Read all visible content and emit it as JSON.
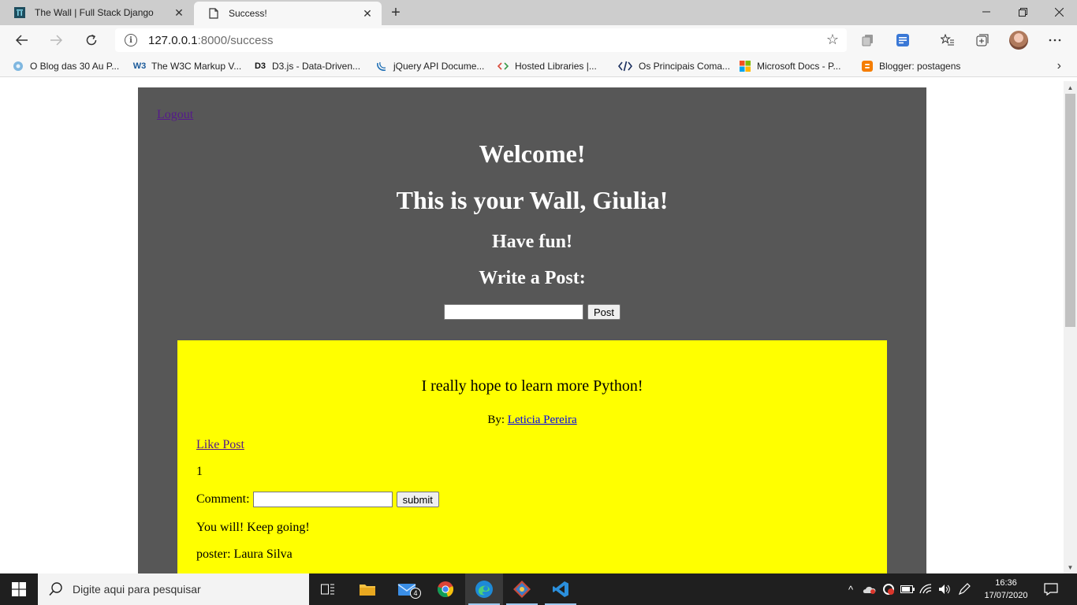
{
  "browser": {
    "tabs": [
      {
        "title": "The Wall | Full Stack Django",
        "active": false
      },
      {
        "title": "Success!",
        "active": true
      }
    ],
    "address": {
      "host": "127.0.0.1",
      "path": ":8000/success"
    },
    "bookmarks": [
      {
        "label": "O Blog das 30 Au P...",
        "icon": "globe-icon"
      },
      {
        "label": "The W3C Markup V...",
        "icon": "w3c-icon"
      },
      {
        "label": "D3.js - Data-Driven...",
        "icon": "d3-icon"
      },
      {
        "label": "jQuery API Docume...",
        "icon": "jquery-icon"
      },
      {
        "label": "Hosted Libraries  |...",
        "icon": "code-icon"
      },
      {
        "label": "Os Principais Coma...",
        "icon": "code-tag-icon"
      },
      {
        "label": "Microsoft Docs - P...",
        "icon": "microsoft-icon"
      },
      {
        "label": "Blogger: postagens",
        "icon": "blogger-icon"
      }
    ]
  },
  "page": {
    "logout_label": "Logout",
    "welcome": "Welcome!",
    "wall_title": "This is your Wall, Giulia!",
    "have_fun": "Have fun!",
    "write_post": "Write a Post:",
    "post_button": "Post",
    "post": {
      "content": "I really hope to learn more Python!",
      "by_prefix": "By:",
      "author": "Leticia Pereira",
      "like_label": "Like Post",
      "like_count": "1",
      "comment_label": "Comment:",
      "submit_label": "submit",
      "comment_text": "You will! Keep going!",
      "comment_poster": "poster: Laura Silva"
    }
  },
  "taskbar": {
    "search_placeholder": "Digite aqui para pesquisar",
    "mail_badge": "4",
    "time": "16:36",
    "date": "17/07/2020"
  }
}
